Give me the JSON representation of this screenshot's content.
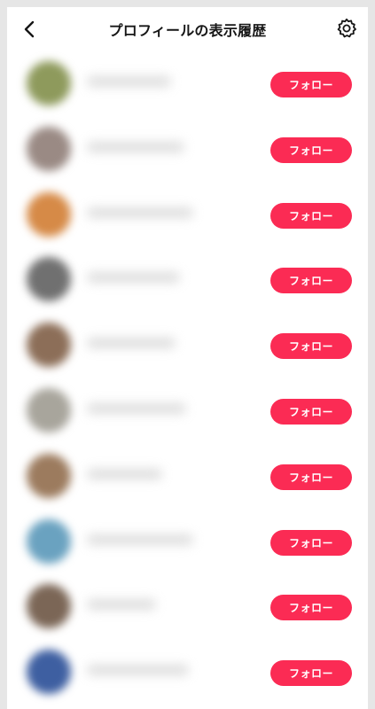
{
  "header": {
    "title": "プロフィールの表示履歴",
    "back_icon": "chevron-left-icon",
    "settings_icon": "gear-icon"
  },
  "colors": {
    "accent": "#fb2b54",
    "background": "#ffffff",
    "outer": "#e6e6e6"
  },
  "rows": [
    {
      "follow_label": "フォロー",
      "avatar_color": "#8e9a5c"
    },
    {
      "follow_label": "フォロー",
      "avatar_color": "#9a8a84"
    },
    {
      "follow_label": "フォロー",
      "avatar_color": "#d68a47"
    },
    {
      "follow_label": "フォロー",
      "avatar_color": "#707070"
    },
    {
      "follow_label": "フォロー",
      "avatar_color": "#8c6e58"
    },
    {
      "follow_label": "フォロー",
      "avatar_color": "#a8a59c"
    },
    {
      "follow_label": "フォロー",
      "avatar_color": "#9c7b5e"
    },
    {
      "follow_label": "フォロー",
      "avatar_color": "#6aa2c0"
    },
    {
      "follow_label": "フォロー",
      "avatar_color": "#7b6656"
    },
    {
      "follow_label": "フォロー",
      "avatar_color": "#3e5fa1"
    }
  ]
}
